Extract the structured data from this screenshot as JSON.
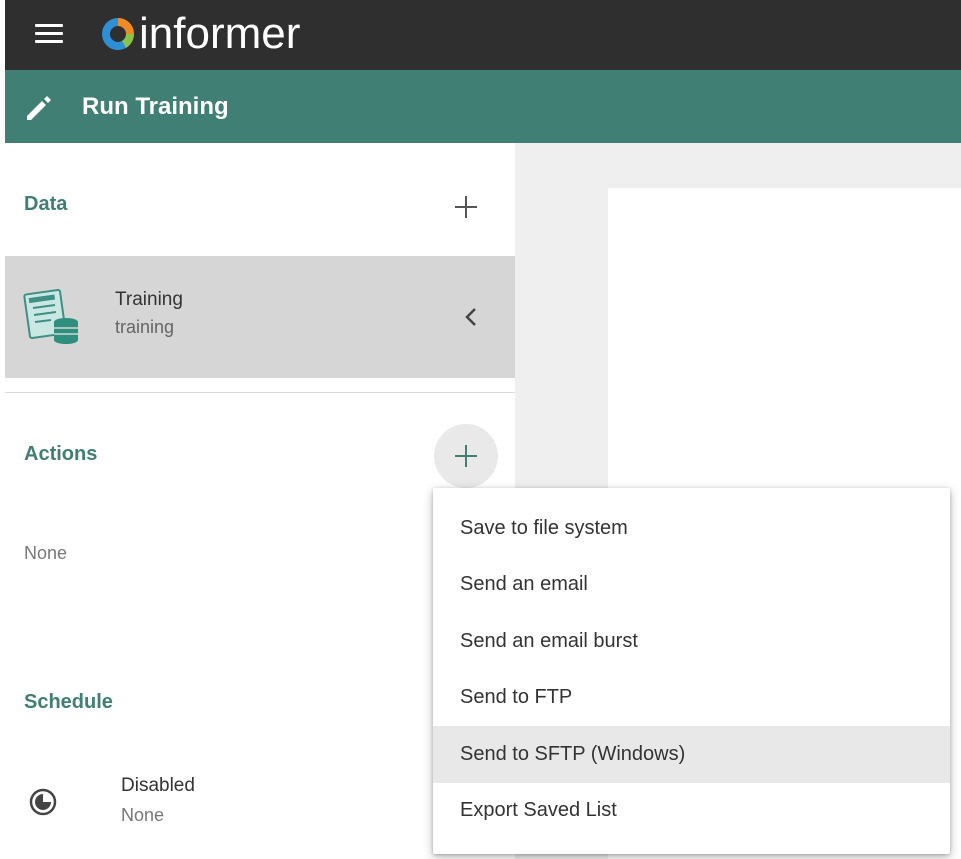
{
  "app": {
    "logo_text": "informer",
    "page_title": "Run Training"
  },
  "sections": {
    "data": {
      "title": "Data",
      "item": {
        "name": "Training",
        "subtitle": "training"
      }
    },
    "actions": {
      "title": "Actions",
      "empty_text": "None"
    },
    "schedule": {
      "title": "Schedule",
      "status": "Disabled",
      "detail": "None"
    }
  },
  "action_menu": {
    "items": [
      {
        "label": "Save to file system"
      },
      {
        "label": "Send an email"
      },
      {
        "label": "Send an email burst"
      },
      {
        "label": "Send to FTP"
      },
      {
        "label": "Send to SFTP (Windows)"
      },
      {
        "label": "Export Saved List"
      }
    ],
    "highlighted_index": 4
  },
  "colors": {
    "topbar": "#2f2f2f",
    "accent": "#3f7f74",
    "selected_bg": "#d6d6d6",
    "logo_orange": "#f08a24",
    "logo_blue": "#2e8fd6"
  },
  "icons": {
    "menu": "hamburger-icon",
    "edit": "pencil-icon",
    "add": "plus-icon",
    "collapse": "chevron-left-icon",
    "dataset": "dataset-icon",
    "schedule": "schedule-icon"
  }
}
